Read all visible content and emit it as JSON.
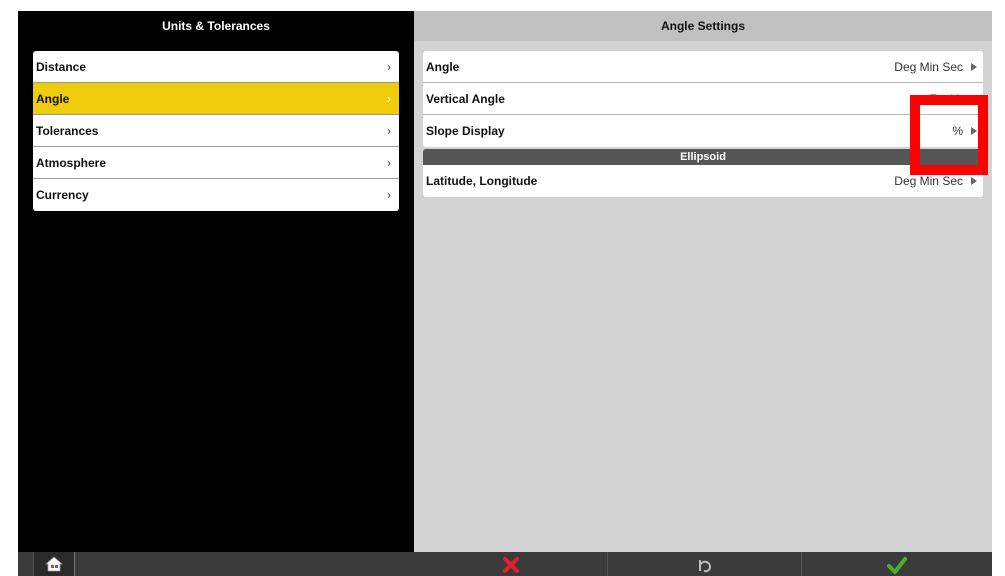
{
  "left_panel": {
    "title": "Units & Tolerances",
    "items": [
      {
        "label": "Distance",
        "selected": false
      },
      {
        "label": "Angle",
        "selected": true
      },
      {
        "label": "Tolerances",
        "selected": false
      },
      {
        "label": "Atmosphere",
        "selected": false
      },
      {
        "label": "Currency",
        "selected": false
      }
    ],
    "chevron": "›"
  },
  "right_panel": {
    "title": "Angle Settings",
    "items": [
      {
        "label": "Angle",
        "value": "Deg Min Sec"
      },
      {
        "label": "Vertical Angle",
        "value": "Zenith"
      },
      {
        "label": "Slope Display",
        "value": "%"
      }
    ],
    "section_header": "Ellipsoid",
    "section_items": [
      {
        "label": "Latitude, Longitude",
        "value": "Deg Min Sec"
      }
    ]
  },
  "bottom_bar": {
    "home_icon": "home-icon",
    "cancel_icon": "red-x-icon",
    "undo_icon": "undo-icon",
    "confirm_icon": "green-check-icon"
  },
  "colors": {
    "selected_highlight": "#f0cd0c",
    "annotation_red": "#ff0000",
    "cancel_red": "#e0202a",
    "confirm_green": "#4caf2a"
  }
}
